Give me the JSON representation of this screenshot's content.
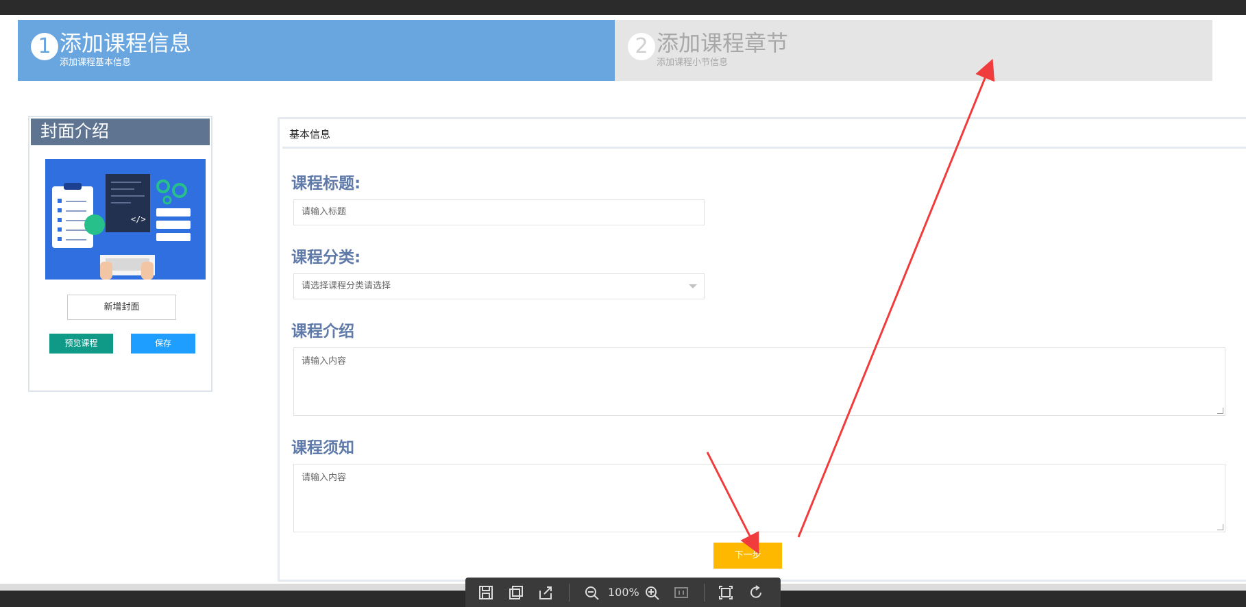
{
  "steps": [
    {
      "number": "1",
      "title": "添加课程信息",
      "subtitle": "添加课程基本信息"
    },
    {
      "number": "2",
      "title": "添加课程章节",
      "subtitle": "添加课程小节信息"
    }
  ],
  "cover": {
    "header": "封面介绍",
    "add_cover_label": "新增封面",
    "preview_label": "预览课程",
    "save_label": "保存"
  },
  "form": {
    "panel_title": "基本信息",
    "title_label": "课程标题:",
    "title_placeholder": "请输入标题",
    "category_label": "课程分类:",
    "category_value": "请选择课程分类请选择",
    "intro_label": "课程介绍",
    "intro_placeholder": "请输入内容",
    "notice_label": "课程须知",
    "notice_placeholder": "请输入内容",
    "next_label": "下一步"
  },
  "viewer": {
    "zoom": "100%",
    "icons": [
      "save-icon",
      "copy-icon",
      "share-icon",
      "zoom-out-icon",
      "zoom-in-icon",
      "actual-size-icon",
      "fit-screen-icon",
      "rotate-icon"
    ]
  },
  "colors": {
    "step_active": "#69a6df",
    "step_inactive": "#e5e5e5",
    "cover_header": "#5e7491",
    "preview_button": "#0f9a88",
    "save_button": "#1e9fff",
    "next_button": "#ffb800",
    "field_label": "#5f79a8",
    "annotation": "#f03c3c"
  }
}
